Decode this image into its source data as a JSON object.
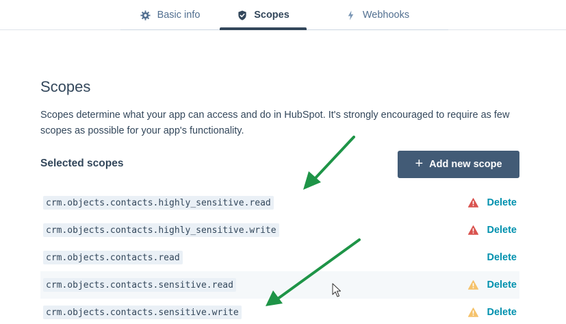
{
  "tabs": [
    {
      "label": "Basic info",
      "icon": "gear-icon"
    },
    {
      "label": "Scopes",
      "icon": "shield-check-icon"
    },
    {
      "label": "Webhooks",
      "icon": "lightning-icon"
    }
  ],
  "page": {
    "title": "Scopes",
    "description": "Scopes determine what your app can access and do in HubSpot. It's strongly encouraged to require as few scopes as possible for your app's functionality.",
    "selected_heading": "Selected scopes",
    "add_button": "Add new scope"
  },
  "scopes": [
    {
      "name": "crm.objects.contacts.highly_sensitive.read",
      "warning": "danger",
      "delete": "Delete"
    },
    {
      "name": "crm.objects.contacts.highly_sensitive.write",
      "warning": "danger",
      "delete": "Delete"
    },
    {
      "name": "crm.objects.contacts.read",
      "warning": "none",
      "delete": "Delete"
    },
    {
      "name": "crm.objects.contacts.sensitive.read",
      "warning": "caution",
      "delete": "Delete"
    },
    {
      "name": "crm.objects.contacts.sensitive.write",
      "warning": "caution",
      "delete": "Delete"
    }
  ],
  "colors": {
    "primary_text": "#33475b",
    "link": "#0091ae",
    "button_bg": "#425b76",
    "danger": "#d9534f",
    "caution": "#f5c26b",
    "annotation_arrow": "#1e9447"
  }
}
